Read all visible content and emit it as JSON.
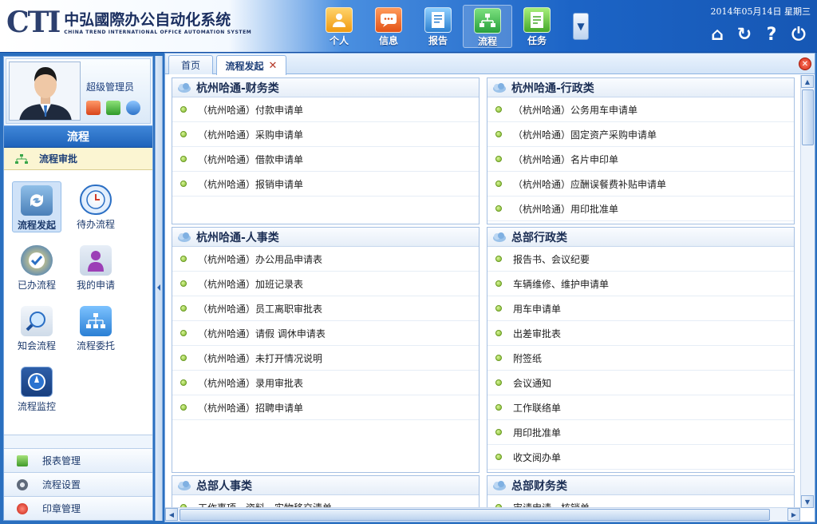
{
  "header": {
    "logo_mark": "CTI",
    "logo_cn": "中弘國際办公自动化系统",
    "logo_en": "CHINA TREND INTERNATIONAL OFFICE AUTOMATION SYSTEM",
    "date": "2014年05月14日 星期三",
    "nav": [
      {
        "label": "个人",
        "icon": "person-icon",
        "color": "#f0a722"
      },
      {
        "label": "信息",
        "icon": "message-icon",
        "color": "#e8632a"
      },
      {
        "label": "报告",
        "icon": "report-icon",
        "color": "#3a8fd8"
      },
      {
        "label": "流程",
        "icon": "flow-icon",
        "color": "#3aa64a"
      },
      {
        "label": "任务",
        "icon": "task-icon",
        "color": "#57b93a"
      }
    ],
    "more_symbol": "▼",
    "tools": [
      "⌂",
      "↻",
      "?",
      "⏻"
    ]
  },
  "sidebar": {
    "user_name": "超级管理员",
    "section_title": "流程",
    "subhead": "流程审批",
    "launchers": [
      {
        "label": "流程发起",
        "icon": "flow-start-icon",
        "active": true
      },
      {
        "label": "待办流程",
        "icon": "clock-icon",
        "active": false
      },
      {
        "label": "已办流程",
        "icon": "checkmark-icon",
        "active": false
      },
      {
        "label": "我的申请",
        "icon": "user-request-icon",
        "active": false
      },
      {
        "label": "知会流程",
        "icon": "magnifier-icon",
        "active": false
      },
      {
        "label": "流程委托",
        "icon": "org-chart-icon",
        "active": false
      },
      {
        "label": "流程监控",
        "icon": "compass-icon",
        "active": false
      }
    ],
    "bottom": [
      {
        "label": "报表管理",
        "icon": "chart-icon"
      },
      {
        "label": "流程设置",
        "icon": "gear-icon"
      },
      {
        "label": "印章管理",
        "icon": "seal-icon"
      }
    ]
  },
  "tabs": [
    {
      "label": "首页",
      "active": false
    },
    {
      "label": "流程发起",
      "active": true,
      "close": "✕"
    }
  ],
  "panels": [
    {
      "title": "杭州哈通-财务类",
      "items": [
        "（杭州哈通）付款申请单",
        "（杭州哈通）采购申请单",
        "（杭州哈通）借款申请单",
        "（杭州哈通）报销申请单"
      ]
    },
    {
      "title": "杭州哈通-行政类",
      "items": [
        "（杭州哈通）公务用车申请单",
        "（杭州哈通）固定资产采购申请单",
        "（杭州哈通）名片申印单",
        "（杭州哈通）应酬误餐费补贴申请单",
        "（杭州哈通）用印批准单"
      ]
    },
    {
      "title": "杭州哈通-人事类",
      "items": [
        "（杭州哈通）办公用品申请表",
        "（杭州哈通）加班记录表",
        "（杭州哈通）员工离职审批表",
        "（杭州哈通）请假 调休申请表",
        "（杭州哈通）未打开情况说明",
        "（杭州哈通）录用审批表",
        "（杭州哈通）招聘申请单"
      ]
    },
    {
      "title": "总部行政类",
      "items": [
        "报告书、会议纪要",
        "车辆维修、维护申请单",
        "用车申请单",
        "出差审批表",
        "附签纸",
        "会议通知",
        "工作联络单",
        "用印批准单",
        "收文阅办单"
      ]
    },
    {
      "title": "总部人事类",
      "items": [
        "工作事项、资料、实物移交清单"
      ]
    },
    {
      "title": "总部财务类",
      "items": [
        "审请申请、核销单"
      ]
    }
  ]
}
